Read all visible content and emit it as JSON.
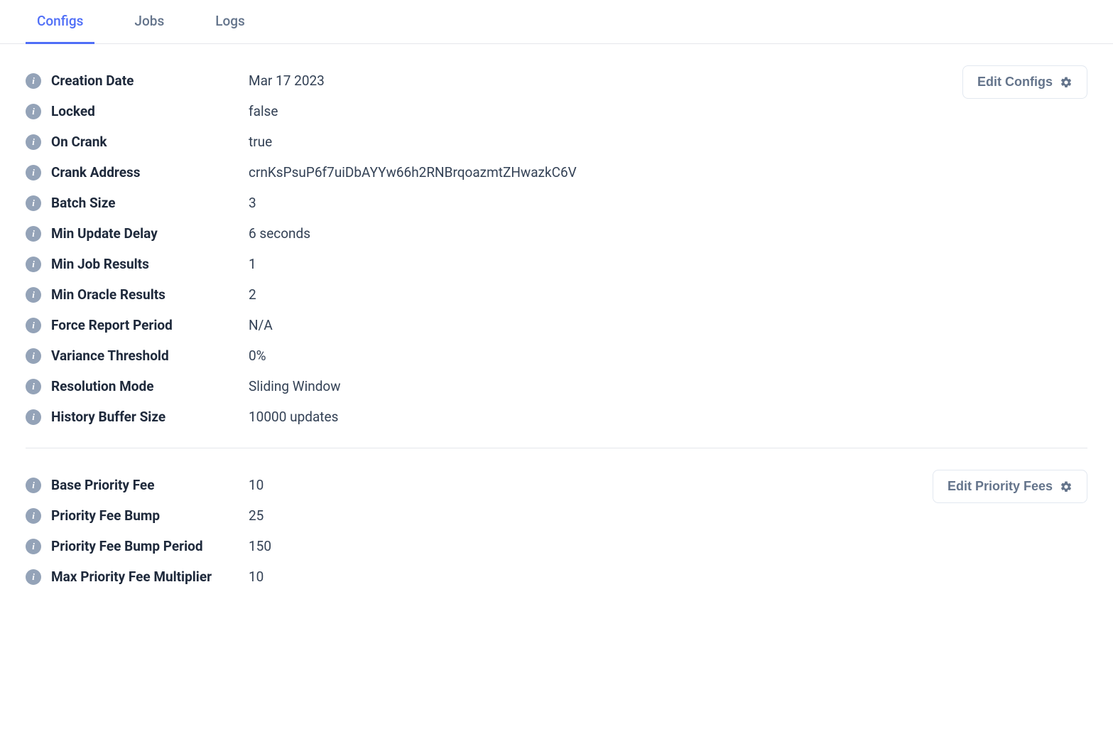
{
  "tabs": [
    {
      "label": "Configs",
      "active": true
    },
    {
      "label": "Jobs",
      "active": false
    },
    {
      "label": "Logs",
      "active": false
    }
  ],
  "sections": {
    "configs": {
      "editLabel": "Edit Configs",
      "rows": [
        {
          "label": "Creation Date",
          "value": "Mar 17 2023"
        },
        {
          "label": "Locked",
          "value": "false"
        },
        {
          "label": "On Crank",
          "value": "true"
        },
        {
          "label": "Crank Address",
          "value": "crnKsPsuP6f7uiDbAYYw66h2RNBrqoazmtZHwazkC6V"
        },
        {
          "label": "Batch Size",
          "value": "3"
        },
        {
          "label": "Min Update Delay",
          "value": "6 seconds"
        },
        {
          "label": "Min Job Results",
          "value": "1"
        },
        {
          "label": "Min Oracle Results",
          "value": "2"
        },
        {
          "label": "Force Report Period",
          "value": "N/A"
        },
        {
          "label": "Variance Threshold",
          "value": "0%"
        },
        {
          "label": "Resolution Mode",
          "value": "Sliding Window"
        },
        {
          "label": "History Buffer Size",
          "value": "10000 updates"
        }
      ]
    },
    "priorityFees": {
      "editLabel": "Edit Priority Fees",
      "rows": [
        {
          "label": "Base Priority Fee",
          "value": "10"
        },
        {
          "label": "Priority Fee Bump",
          "value": "25"
        },
        {
          "label": "Priority Fee Bump Period",
          "value": "150"
        },
        {
          "label": "Max Priority Fee Multiplier",
          "value": "10"
        }
      ]
    }
  }
}
